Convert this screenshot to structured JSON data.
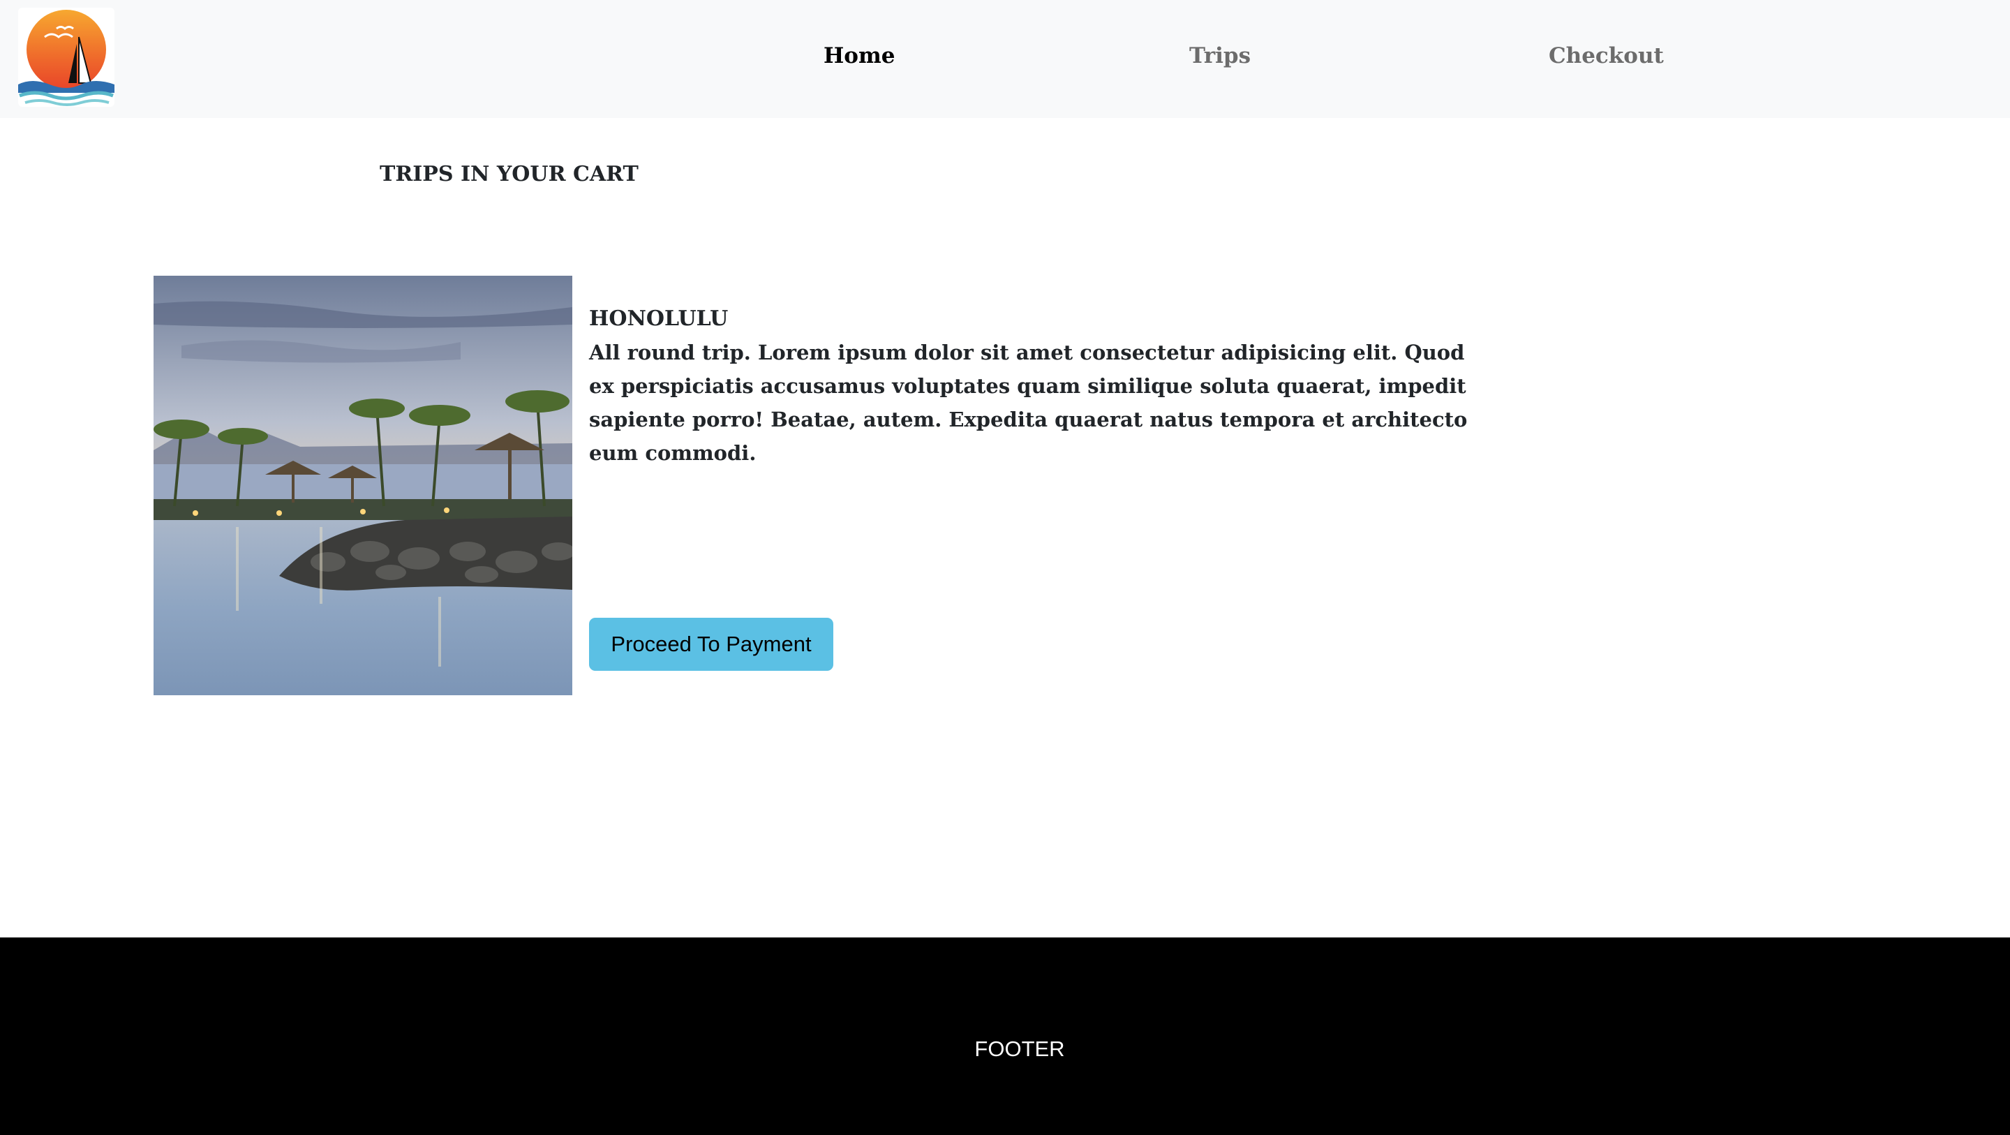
{
  "header": {
    "logo_icon": "sunset-sailboat-logo-icon",
    "nav": [
      {
        "label": "Home",
        "active": true
      },
      {
        "label": "Trips",
        "active": false
      },
      {
        "label": "Checkout",
        "active": false
      }
    ]
  },
  "cart": {
    "heading": "TRIPS IN YOUR CART",
    "items": [
      {
        "title": "HONOLULU",
        "description": "All round trip. Lorem ipsum dolor sit amet consectetur adipisicing elit. Quod ex perspiciatis accusamus voluptates quam similique soluta quaerat, impedit sapiente porro! Beatae, autem. Expedita quaerat natus tempora et architecto eum commodi.",
        "image_icon": "tropical-beach-resort-image",
        "button_label": "Proceed To Payment"
      }
    ]
  },
  "footer": {
    "text": "FOOTER"
  },
  "colors": {
    "navbar_bg": "#f8f9fa",
    "nav_active": "#000000",
    "nav_inactive": "#6c6c6c",
    "button_bg": "#5bc0e4",
    "footer_bg": "#000000",
    "footer_text": "#ffffff"
  }
}
